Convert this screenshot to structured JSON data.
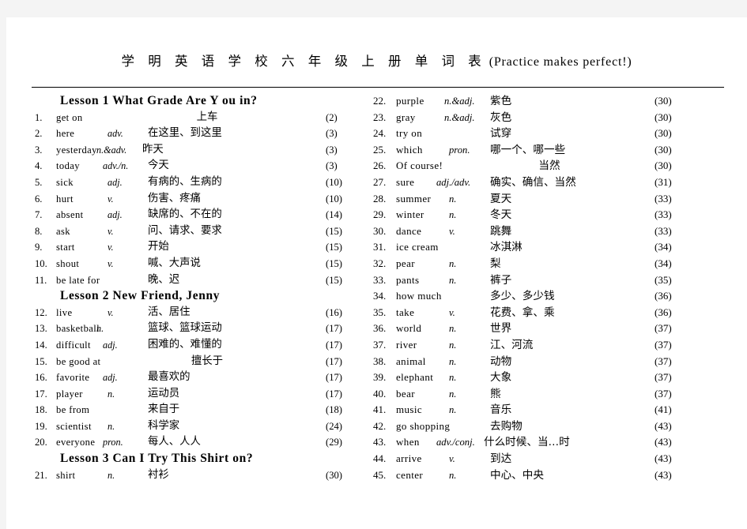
{
  "document": {
    "title_cn": "学 明 英 语 学 校 六 年 级 上 册 单 词 表",
    "title_en": "(Practice makes perfect!)"
  },
  "columns": {
    "left": [
      {
        "kind": "lesson",
        "heading": "Lesson 1    What Grade Are Y ou in?"
      },
      {
        "kind": "entry",
        "num": "1.",
        "word": "get on",
        "pos": "",
        "cn": "上车",
        "cn_center": true,
        "page": "(2)"
      },
      {
        "kind": "entry",
        "num": "2.",
        "word": "here",
        "pos": "adv.",
        "cn": "在这里、到这里",
        "cn_center": false,
        "page": "(3)"
      },
      {
        "kind": "entry",
        "num": "3.",
        "word": "yesterday",
        "pos": "n.&adv.",
        "cn": "昨天",
        "cn_center": false,
        "page": "(3)",
        "pos_shift": "wider",
        "cn_tight": true
      },
      {
        "kind": "entry",
        "num": "4.",
        "word": "today",
        "pos": "adv./n.",
        "cn": "今天",
        "cn_center": false,
        "page": "(3)",
        "pos_shift": "wide"
      },
      {
        "kind": "entry",
        "num": "5.",
        "word": "sick",
        "pos": "adj.",
        "cn": "有病的、生病的",
        "cn_center": false,
        "page": "(10)"
      },
      {
        "kind": "entry",
        "num": "6.",
        "word": "hurt",
        "pos": "v.",
        "cn": "伤害、疼痛",
        "cn_center": false,
        "page": "(10)"
      },
      {
        "kind": "entry",
        "num": "7.",
        "word": "absent",
        "pos": "adj.",
        "cn": "缺席的、不在的",
        "cn_center": false,
        "page": "(14)"
      },
      {
        "kind": "entry",
        "num": "8.",
        "word": "ask",
        "pos": "v.",
        "cn": "问、请求、要求",
        "cn_center": false,
        "page": "(15)"
      },
      {
        "kind": "entry",
        "num": "9.",
        "word": "start",
        "pos": "v.",
        "cn": "开始",
        "cn_center": false,
        "page": "(15)"
      },
      {
        "kind": "entry",
        "num": "10.",
        "word": "shout",
        "pos": "v.",
        "cn": "喊、大声说",
        "cn_center": false,
        "page": "(15)"
      },
      {
        "kind": "entry",
        "num": "11.",
        "word": "be late for",
        "pos": "",
        "cn": "晚、迟",
        "cn_center": false,
        "page": "(15)"
      },
      {
        "kind": "lesson",
        "heading": "Lesson 2 New Friend, Jenny"
      },
      {
        "kind": "entry",
        "num": "12.",
        "word": "live",
        "pos": "v.",
        "cn": "活、居住",
        "cn_center": false,
        "page": "(16)"
      },
      {
        "kind": "entry",
        "num": "13.",
        "word": "basketball",
        "pos": "n.",
        "cn": "篮球、篮球运动",
        "cn_center": false,
        "page": "(17)",
        "pos_shift": "wider"
      },
      {
        "kind": "entry",
        "num": "14.",
        "word": "difficult",
        "pos": "adj.",
        "cn": "困难的、难懂的",
        "cn_center": false,
        "page": "(17)",
        "pos_shift": "wide"
      },
      {
        "kind": "entry",
        "num": "15.",
        "word": "be good at",
        "pos": "",
        "cn": "擅长于",
        "cn_center": true,
        "page": "(17)"
      },
      {
        "kind": "entry",
        "num": "16.",
        "word": "favorite",
        "pos": "adj.",
        "cn": "最喜欢的",
        "cn_center": false,
        "page": "(17)",
        "pos_shift": "wide"
      },
      {
        "kind": "entry",
        "num": "17.",
        "word": "player",
        "pos": "n.",
        "cn": "运动员",
        "cn_center": false,
        "page": "(17)"
      },
      {
        "kind": "entry",
        "num": "18.",
        "word": "be from",
        "pos": "",
        "cn": "来自于",
        "cn_center": false,
        "page": "(18)"
      },
      {
        "kind": "entry",
        "num": "19.",
        "word": "scientist",
        "pos": "n.",
        "cn": "科学家",
        "cn_center": false,
        "page": "(24)"
      },
      {
        "kind": "entry",
        "num": "20.",
        "word": "everyone",
        "pos": "pron.",
        "cn": "每人、人人",
        "cn_center": false,
        "page": "(29)",
        "pos_shift": "wide"
      },
      {
        "kind": "lesson",
        "heading": "Lesson 3 Can I Try This Shirt on?"
      },
      {
        "kind": "entry",
        "num": "21.",
        "word": "shirt",
        "pos": "n.",
        "cn": "衬衫",
        "cn_center": false,
        "page": "(30)"
      }
    ],
    "right": [
      {
        "kind": "entry",
        "num": "22.",
        "word": "purple",
        "pos": "n.&adj.",
        "cn": "紫色",
        "cn_center": false,
        "page": "(30)",
        "pos_shift": "wide"
      },
      {
        "kind": "entry",
        "num": "23.",
        "word": "gray",
        "pos": "n.&adj.",
        "cn": "灰色",
        "cn_center": false,
        "page": "(30)",
        "pos_shift": "wide"
      },
      {
        "kind": "entry",
        "num": "24.",
        "word": "try on",
        "pos": "",
        "cn": "试穿",
        "cn_center": false,
        "page": "(30)"
      },
      {
        "kind": "entry",
        "num": "25.",
        "word": "which",
        "pos": "pron.",
        "cn": "哪一个、哪一些",
        "cn_center": false,
        "page": "(30)"
      },
      {
        "kind": "entry",
        "num": "26.",
        "word": "Of course!",
        "pos": "",
        "cn": "当然",
        "cn_center": true,
        "page": "(30)"
      },
      {
        "kind": "entry",
        "num": "27.",
        "word": "sure",
        "pos": "adj./adv.",
        "cn": "确实、确信、当然",
        "cn_center": false,
        "page": "(31)",
        "pos_shift": "wider"
      },
      {
        "kind": "entry",
        "num": "28.",
        "word": "summer",
        "pos": "n.",
        "cn": "夏天",
        "cn_center": false,
        "page": "(33)"
      },
      {
        "kind": "entry",
        "num": "29.",
        "word": "winter",
        "pos": "n.",
        "cn": "冬天",
        "cn_center": false,
        "page": "(33)"
      },
      {
        "kind": "entry",
        "num": "30.",
        "word": "dance",
        "pos": "v.",
        "cn": "跳舞",
        "cn_center": false,
        "page": "(33)"
      },
      {
        "kind": "entry",
        "num": "31.",
        "word": "ice cream",
        "pos": "",
        "cn": "冰淇淋",
        "cn_center": false,
        "page": "(34)"
      },
      {
        "kind": "entry",
        "num": "32.",
        "word": "pear",
        "pos": "n.",
        "cn": "梨",
        "cn_center": false,
        "page": "(34)"
      },
      {
        "kind": "entry",
        "num": "33.",
        "word": "pants",
        "pos": "n.",
        "cn": "裤子",
        "cn_center": false,
        "page": "(35)"
      },
      {
        "kind": "entry",
        "num": "34.",
        "word": "how much",
        "pos": "",
        "cn": "多少、多少钱",
        "cn_center": false,
        "page": "(36)"
      },
      {
        "kind": "entry",
        "num": "35.",
        "word": "take",
        "pos": "v.",
        "cn": "花费、拿、乘",
        "cn_center": false,
        "page": "(36)"
      },
      {
        "kind": "entry",
        "num": "36.",
        "word": "world",
        "pos": "n.",
        "cn": "世界",
        "cn_center": false,
        "page": "(37)"
      },
      {
        "kind": "entry",
        "num": "37.",
        "word": "river",
        "pos": "n.",
        "cn": "江、河流",
        "cn_center": false,
        "page": "(37)"
      },
      {
        "kind": "entry",
        "num": "38.",
        "word": "animal",
        "pos": "n.",
        "cn": "动物",
        "cn_center": false,
        "page": "(37)"
      },
      {
        "kind": "entry",
        "num": "39.",
        "word": "elephant",
        "pos": "n.",
        "cn": "大象",
        "cn_center": false,
        "page": "(37)"
      },
      {
        "kind": "entry",
        "num": "40.",
        "word": "bear",
        "pos": "n.",
        "cn": "熊",
        "cn_center": false,
        "page": "(37)"
      },
      {
        "kind": "entry",
        "num": "41.",
        "word": "music",
        "pos": "n.",
        "cn": "音乐",
        "cn_center": false,
        "page": "(41)"
      },
      {
        "kind": "entry",
        "num": "42.",
        "word": "go shopping",
        "pos": "",
        "cn": "去购物",
        "cn_center": false,
        "page": "(43)"
      },
      {
        "kind": "entry",
        "num": "43.",
        "word": "when",
        "pos": "adv./conj.",
        "cn": "什么时候、当…时",
        "cn_center": false,
        "page": "(43)",
        "pos_shift": "wider",
        "cn_tight": true
      },
      {
        "kind": "entry",
        "num": "44.",
        "word": "arrive",
        "pos": "v.",
        "cn": "到达",
        "cn_center": false,
        "page": "(43)"
      },
      {
        "kind": "entry",
        "num": "45.",
        "word": "center",
        "pos": "n.",
        "cn": "中心、中央",
        "cn_center": false,
        "page": "(43)"
      }
    ]
  }
}
